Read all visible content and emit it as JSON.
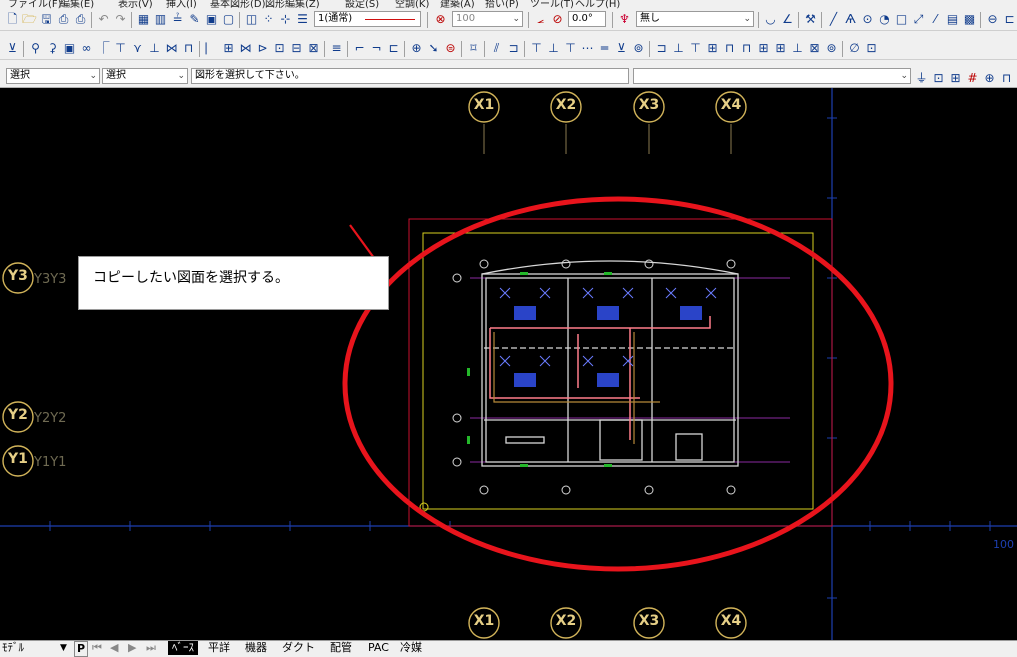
{
  "menu": [
    "ファイル(F)",
    "編集(E)",
    "表示(V)",
    "挿入(I)",
    "基本図形(D)",
    "図形編集(Z)",
    "設定(S)",
    "空調(K)",
    "建築(A)",
    "拾い(P)",
    "ツール(T)",
    "ヘルプ(H)"
  ],
  "toolbar1": {
    "layer_value": "1(通常)",
    "scale_value": "100",
    "angle_value": "0.0°",
    "fill_value": "無し"
  },
  "toolbar3": {
    "mode_select": "選択",
    "target_select": "選択",
    "prompt": "図形を選択して下さい。"
  },
  "canvas": {
    "callout_text": "コピーしたい図面を選択する。",
    "grid_x_top": [
      "X1",
      "X2",
      "X3",
      "X4"
    ],
    "grid_x_bottom": [
      "X1",
      "X2",
      "X3",
      "X4"
    ],
    "grid_y": [
      "Y3",
      "Y2",
      "Y1"
    ],
    "ruler_label": "100",
    "highlight_color": "#e8141c"
  },
  "statusbar": {
    "model_label": "ﾓﾃﾞﾙ",
    "p_button": "P",
    "tabs": [
      "ﾍﾞｰｽ",
      "平詳",
      "機器",
      "ダクト",
      "配管",
      "PAC",
      "冷媒"
    ]
  }
}
